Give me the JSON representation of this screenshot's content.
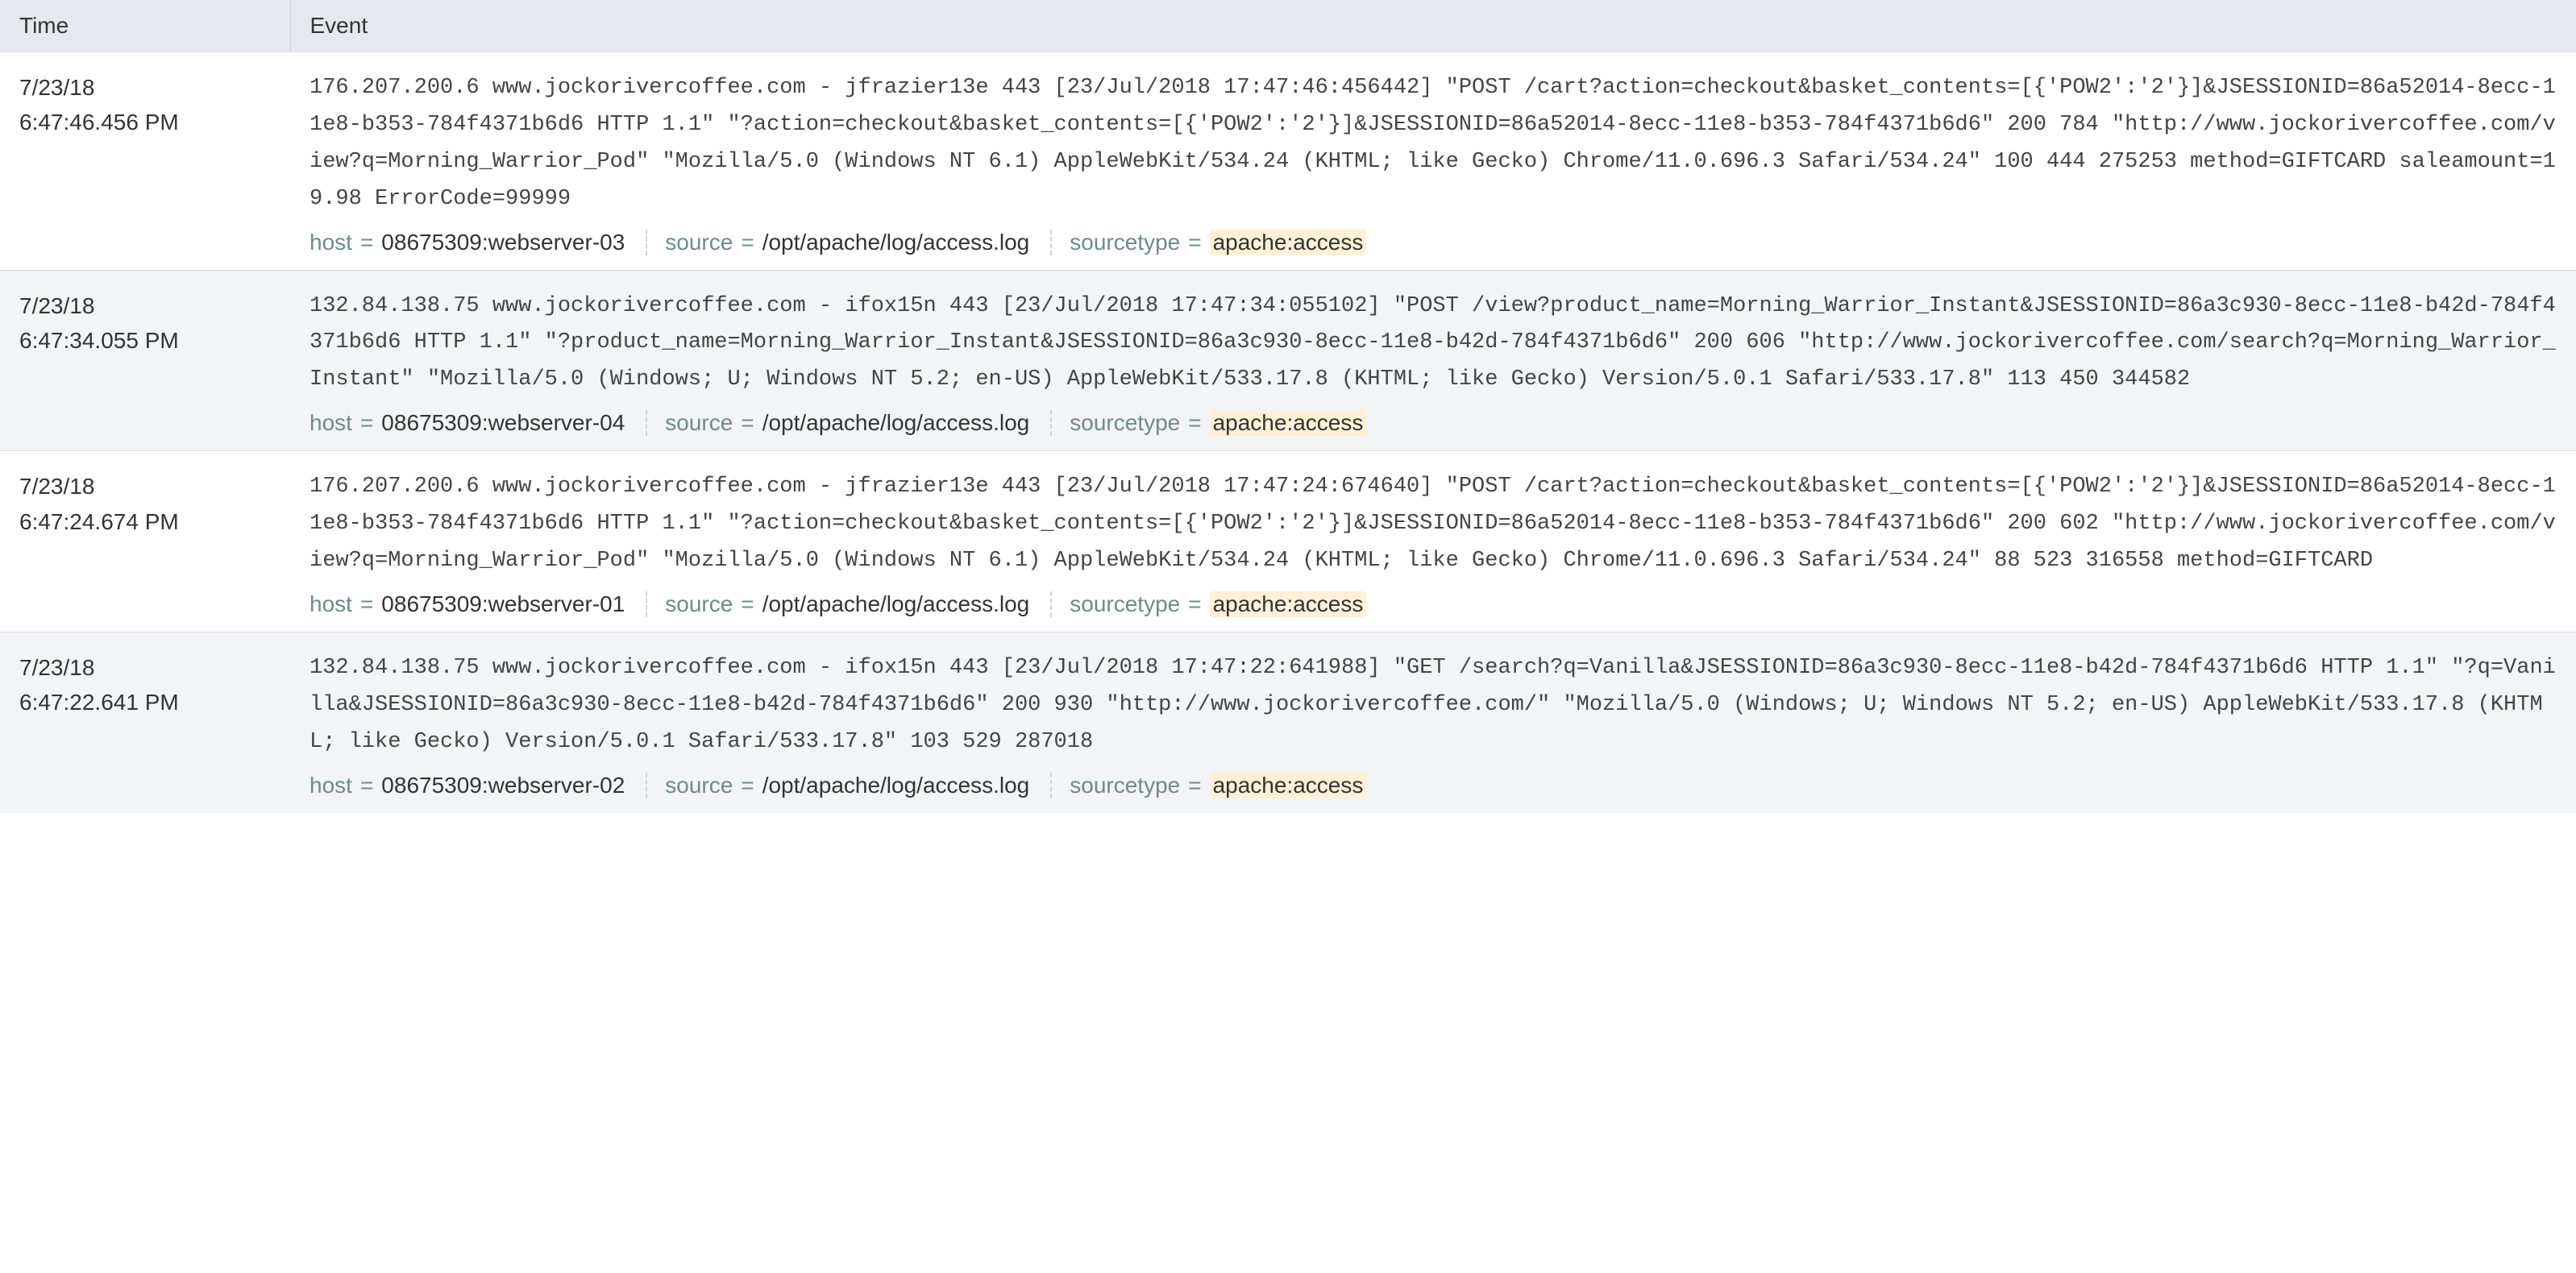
{
  "header": {
    "time_label": "Time",
    "event_label": "Event"
  },
  "meta_labels": {
    "host": "host",
    "source": "source",
    "sourcetype": "sourcetype",
    "eq": "="
  },
  "events": [
    {
      "date": "7/23/18",
      "time": "6:47:46.456 PM",
      "raw": "176.207.200.6 www.jockorivercoffee.com - jfrazier13e 443 [23/Jul/2018 17:47:46:456442] \"POST /cart?action=checkout&basket_contents=[{'POW2':'2'}]&JSESSIONID=86a52014-8ecc-11e8-b353-784f4371b6d6 HTTP 1.1\" \"?action=checkout&basket_contents=[{'POW2':'2'}]&JSESSIONID=86a52014-8ecc-11e8-b353-784f4371b6d6\" 200 784 \"http://www.jockorivercoffee.com/view?q=Morning_Warrior_Pod\" \"Mozilla/5.0 (Windows NT 6.1) AppleWebKit/534.24 (KHTML; like Gecko) Chrome/11.0.696.3 Safari/534.24\" 100 444 275253 method=GIFTCARD saleamount=19.98 ErrorCode=99999",
      "host": "08675309:webserver-03",
      "source": "/opt/apache/log/access.log",
      "sourcetype": "apache:access"
    },
    {
      "date": "7/23/18",
      "time": "6:47:34.055 PM",
      "raw": "132.84.138.75 www.jockorivercoffee.com - ifox15n 443 [23/Jul/2018 17:47:34:055102] \"POST /view?product_name=Morning_Warrior_Instant&JSESSIONID=86a3c930-8ecc-11e8-b42d-784f4371b6d6 HTTP 1.1\" \"?product_name=Morning_Warrior_Instant&JSESSIONID=86a3c930-8ecc-11e8-b42d-784f4371b6d6\" 200 606 \"http://www.jockorivercoffee.com/search?q=Morning_Warrior_Instant\" \"Mozilla/5.0 (Windows; U; Windows NT 5.2; en-US) AppleWebKit/533.17.8 (KHTML; like Gecko) Version/5.0.1 Safari/533.17.8\" 113 450 344582",
      "host": "08675309:webserver-04",
      "source": "/opt/apache/log/access.log",
      "sourcetype": "apache:access"
    },
    {
      "date": "7/23/18",
      "time": "6:47:24.674 PM",
      "raw": "176.207.200.6 www.jockorivercoffee.com - jfrazier13e 443 [23/Jul/2018 17:47:24:674640] \"POST /cart?action=checkout&basket_contents=[{'POW2':'2'}]&JSESSIONID=86a52014-8ecc-11e8-b353-784f4371b6d6 HTTP 1.1\" \"?action=checkout&basket_contents=[{'POW2':'2'}]&JSESSIONID=86a52014-8ecc-11e8-b353-784f4371b6d6\" 200 602 \"http://www.jockorivercoffee.com/view?q=Morning_Warrior_Pod\" \"Mozilla/5.0 (Windows NT 6.1) AppleWebKit/534.24 (KHTML; like Gecko) Chrome/11.0.696.3 Safari/534.24\" 88 523 316558 method=GIFTCARD",
      "host": "08675309:webserver-01",
      "source": "/opt/apache/log/access.log",
      "sourcetype": "apache:access"
    },
    {
      "date": "7/23/18",
      "time": "6:47:22.641 PM",
      "raw": "132.84.138.75 www.jockorivercoffee.com - ifox15n 443 [23/Jul/2018 17:47:22:641988] \"GET /search?q=Vanilla&JSESSIONID=86a3c930-8ecc-11e8-b42d-784f4371b6d6 HTTP 1.1\" \"?q=Vanilla&JSESSIONID=86a3c930-8ecc-11e8-b42d-784f4371b6d6\" 200 930 \"http://www.jockorivercoffee.com/\" \"Mozilla/5.0 (Windows; U; Windows NT 5.2; en-US) AppleWebKit/533.17.8 (KHTML; like Gecko) Version/5.0.1 Safari/533.17.8\" 103 529 287018",
      "host": "08675309:webserver-02",
      "source": "/opt/apache/log/access.log",
      "sourcetype": "apache:access"
    }
  ]
}
